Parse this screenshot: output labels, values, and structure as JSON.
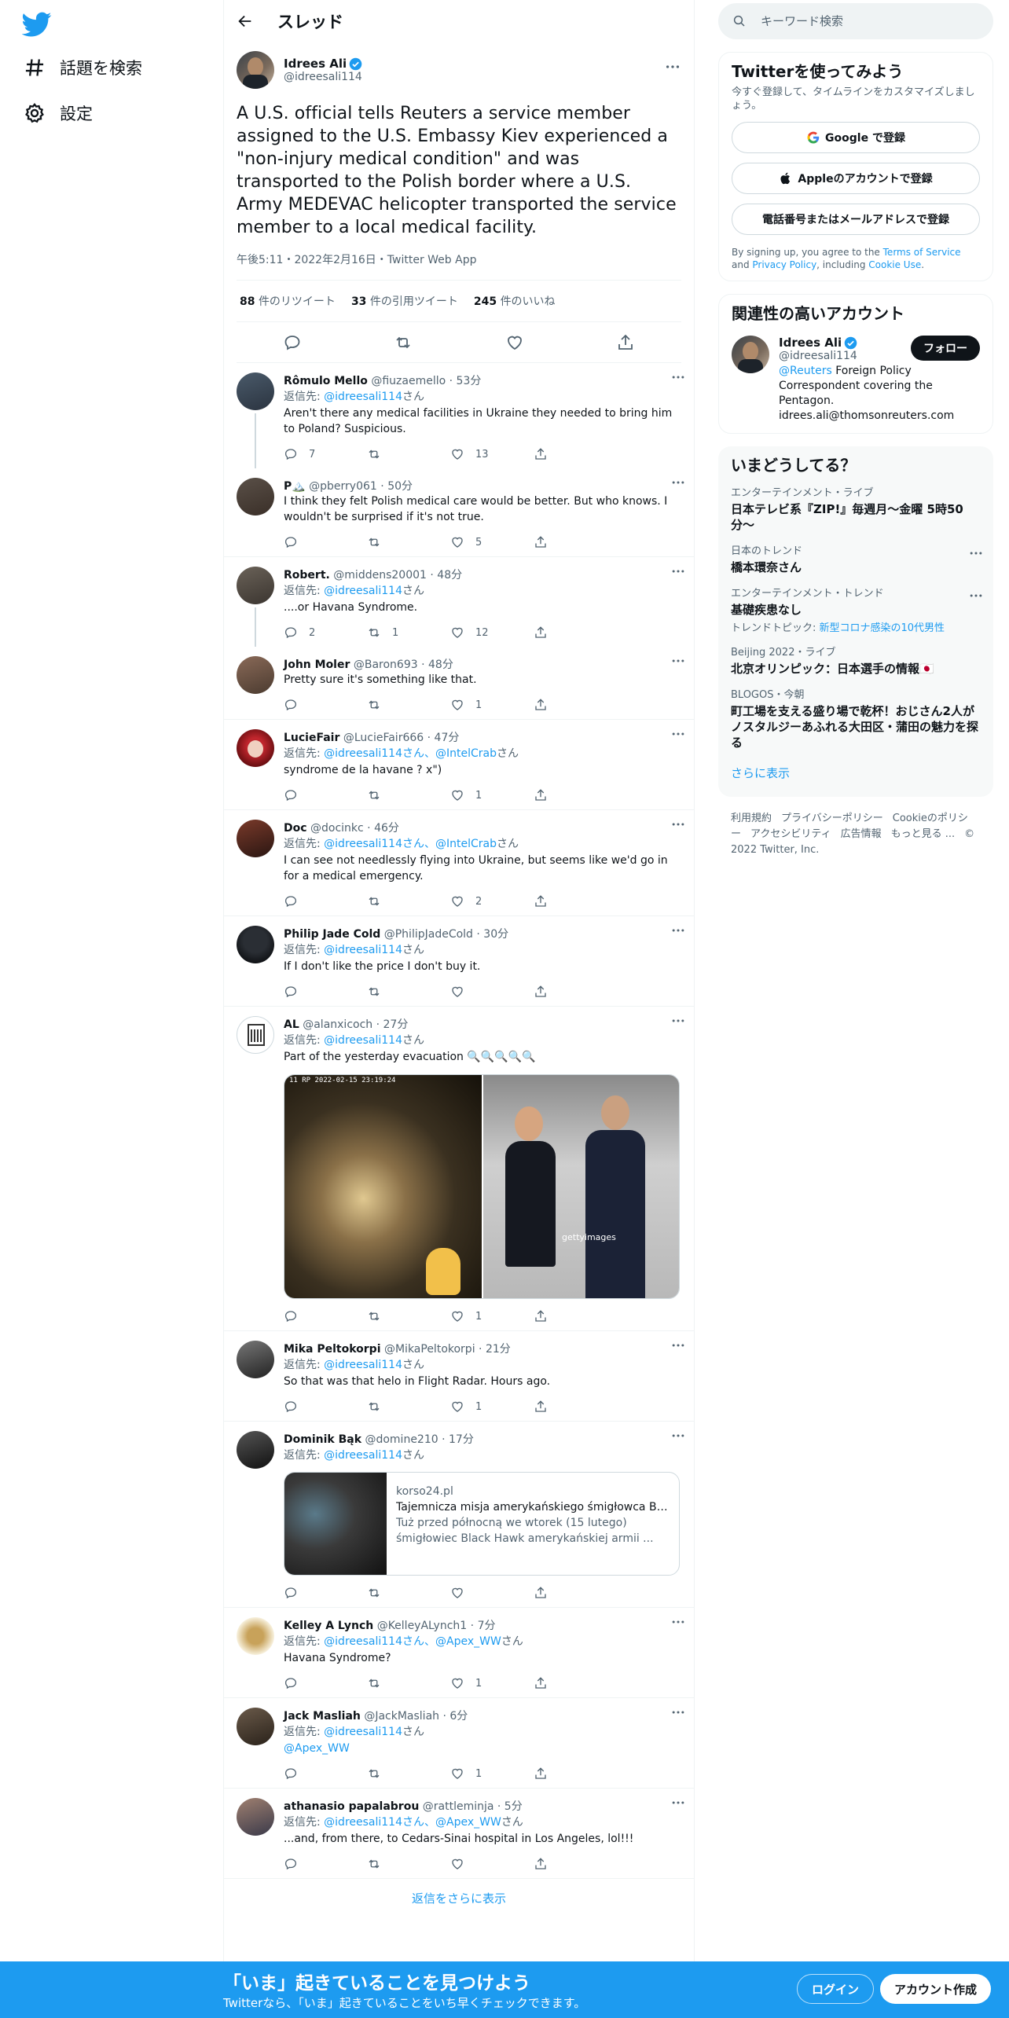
{
  "nav": {
    "explore": "話題を検索",
    "settings": "設定"
  },
  "thread": {
    "header_title": "スレッド",
    "author_name": "Idrees Ali",
    "author_handle": "@idreesali114",
    "text": "A U.S. official tells Reuters a service member assigned to the U.S. Embassy Kiev experienced a \"non-injury medical condition\" and was transported to the Polish border where a U.S. Army MEDEVAC helicopter transported the service member to a local medical facility.",
    "meta": "午後5:11・2022年2月16日・Twitter Web App",
    "retweets_count": "88",
    "retweets_label": "件のリツイート",
    "quotes_count": "33",
    "quotes_label": "件の引用ツイート",
    "likes_count": "245",
    "likes_label": "件のいいね"
  },
  "replies": [
    {
      "name": "Rômulo Mello",
      "handle": "@fiuzaemello",
      "time": "53分",
      "replyto": "返信先: ",
      "replyto_users": "@idreesali114",
      "replyto_suffix": "さん",
      "text": "Aren't there any medical facilities in Ukraine they needed to bring him to Poland? Suspicious.",
      "replies": "7",
      "retweets": "",
      "likes": "13"
    },
    {
      "name": "P🏔️",
      "handle": "@pberry061",
      "time": "50分",
      "replyto": "",
      "replyto_users": "",
      "replyto_suffix": "",
      "text": "I think they felt Polish medical care would be better. But who knows. I wouldn't be surprised if it's not true.",
      "replies": "",
      "retweets": "",
      "likes": "5"
    },
    {
      "name": "Robert.",
      "handle": "@middens20001",
      "time": "48分",
      "replyto": "返信先: ",
      "replyto_users": "@idreesali114",
      "replyto_suffix": "さん",
      "text": "....or Havana Syndrome.",
      "replies": "2",
      "retweets": "1",
      "likes": "12"
    },
    {
      "name": "John Moler",
      "handle": "@Baron693",
      "time": "48分",
      "replyto": "",
      "replyto_users": "",
      "replyto_suffix": "",
      "text": "Pretty sure it's something like that.",
      "replies": "",
      "retweets": "",
      "likes": "1"
    },
    {
      "name": "LucieFair",
      "handle": "@LucieFair666",
      "time": "47分",
      "replyto": "返信先: ",
      "replyto_users": "@idreesali114さん、@IntelCrab",
      "replyto_suffix": "さん",
      "text": "syndrome de la havane ? x\")",
      "replies": "",
      "retweets": "",
      "likes": "1"
    },
    {
      "name": "Doc",
      "handle": "@docinkc",
      "time": "46分",
      "replyto": "返信先: ",
      "replyto_users": "@idreesali114さん、@IntelCrab",
      "replyto_suffix": "さん",
      "text": "I can see not needlessly flying into Ukraine, but seems like we'd go in for a medical emergency.",
      "replies": "",
      "retweets": "",
      "likes": "2"
    },
    {
      "name": "Philip Jade Cold",
      "handle": "@PhilipJadeCold",
      "time": "30分",
      "replyto": "返信先: ",
      "replyto_users": "@idreesali114",
      "replyto_suffix": "さん",
      "text": "If I don't like the price I don't buy it.",
      "replies": "",
      "retweets": "",
      "likes": ""
    },
    {
      "name": "AL",
      "handle": "@alanxicoch",
      "time": "27分",
      "replyto": "返信先: ",
      "replyto_users": "@idreesali114",
      "replyto_suffix": "さん",
      "text": "Part of the yesterday evacuation 🔍🔍🔍🔍🔍",
      "replies": "",
      "retweets": "",
      "likes": "1",
      "media_caption": "11 RP 2022-02-15 23:19:24",
      "media_watermark": "gettyimages"
    },
    {
      "name": "Mika Peltokorpi",
      "handle": "@MikaPeltokorpi",
      "time": "21分",
      "replyto": "返信先: ",
      "replyto_users": "@idreesali114",
      "replyto_suffix": "さん",
      "text": "So that was that helo in Flight Radar. Hours ago.",
      "replies": "",
      "retweets": "",
      "likes": "1"
    },
    {
      "name": "Dominik Bąk",
      "handle": "@domine210",
      "time": "17分",
      "replyto": "返信先: ",
      "replyto_users": "@idreesali114",
      "replyto_suffix": "さん",
      "text": "",
      "replies": "",
      "retweets": "",
      "likes": "",
      "card_domain": "korso24.pl",
      "card_title": "Tajemnicza misja amerykańskiego śmigłowca Blac...",
      "card_desc": "Tuż przed północną we wtorek (15 lutego) śmigłowiec Black Hawk amerykańskiej armii ..."
    },
    {
      "name": "Kelley A Lynch",
      "handle": "@KelleyALynch1",
      "time": "7分",
      "replyto": "返信先: ",
      "replyto_users": "@idreesali114さん、@Apex_WW",
      "replyto_suffix": "さん",
      "text": "Havana Syndrome?",
      "replies": "",
      "retweets": "",
      "likes": "1"
    },
    {
      "name": "Jack Masliah",
      "handle": "@JackMasliah",
      "time": "6分",
      "replyto": "返信先: ",
      "replyto_users": "@idreesali114",
      "replyto_suffix": "さん",
      "text": "@Apex_WW",
      "replies": "",
      "retweets": "",
      "likes": "1"
    },
    {
      "name": "athanasio papalabrou",
      "handle": "@rattleminja",
      "time": "5分",
      "replyto": "返信先: ",
      "replyto_users": "@idreesali114さん、@Apex_WW",
      "replyto_suffix": "さん",
      "text": "...and, from there, to Cedars-Sinai hospital in Los Angeles, lol!!!",
      "replies": "",
      "retweets": "",
      "likes": ""
    }
  ],
  "show_more_replies": "返信をさらに表示",
  "sidebar": {
    "search_placeholder": "キーワード検索",
    "signup_title": "Twitterを使ってみよう",
    "signup_sub": "今すぐ登録して、タイムラインをカスタマイズしましょう。",
    "google_btn": "Google で登録",
    "apple_btn": "Appleのアカウントで登録",
    "phone_btn": "電話番号またはメールアドレスで登録",
    "terms_pre": "By signing up, you agree to the ",
    "terms_tos": "Terms of Service",
    "terms_and": " and ",
    "terms_privacy": "Privacy Policy",
    "terms_including": ", including ",
    "terms_cookie": "Cookie Use",
    "terms_end": ".",
    "relevant_title": "関連性の高いアカウント",
    "rel_name": "Idrees Ali",
    "rel_handle": "@idreesali114",
    "rel_bio_link": "@Reuters",
    "rel_bio": " Foreign Policy Correspondent covering the Pentagon. idrees.ali@thomsonreuters.com",
    "follow": "フォロー",
    "trends_title": "いまどうしてる？",
    "trends": [
      {
        "cat": "エンターテインメント・ライブ",
        "name": "日本テレビ系『ZIP!』毎週月〜金曜 5時50分〜",
        "sub": ""
      },
      {
        "cat": "日本のトレンド",
        "name": "橋本環奈さん",
        "sub": ""
      },
      {
        "cat": "エンターテインメント・トレンド",
        "name": "基礎疾患なし",
        "sub": "トレンドトピック: ",
        "sub_link": "新型コロナ感染の10代男性"
      },
      {
        "cat": "Beijing 2022・ライブ",
        "name": "北京オリンピック：日本選手の情報🇯🇵",
        "sub": ""
      },
      {
        "cat": "BLOGOS・今朝",
        "name": "町工場を支える盛り場で乾杯！おじさん2人がノスタルジーあふれる大田区・蒲田の魅力を探る",
        "sub": ""
      }
    ],
    "show_more": "さらに表示",
    "footer": [
      "利用規約",
      "プライバシーポリシー",
      "Cookieのポリシー",
      "アクセシビリティ",
      "広告情報",
      "もっと見る ...",
      "© 2022 Twitter, Inc."
    ]
  },
  "bottom": {
    "title": "「いま」起きていることを見つけよう",
    "subtitle": "Twitterなら、「いま」起きていることをいち早くチェックできます。",
    "login": "ログイン",
    "signup": "アカウント作成"
  },
  "colors": {
    "accent": "#1d9bf0",
    "text": "#0f1419",
    "secondary": "#536471"
  }
}
